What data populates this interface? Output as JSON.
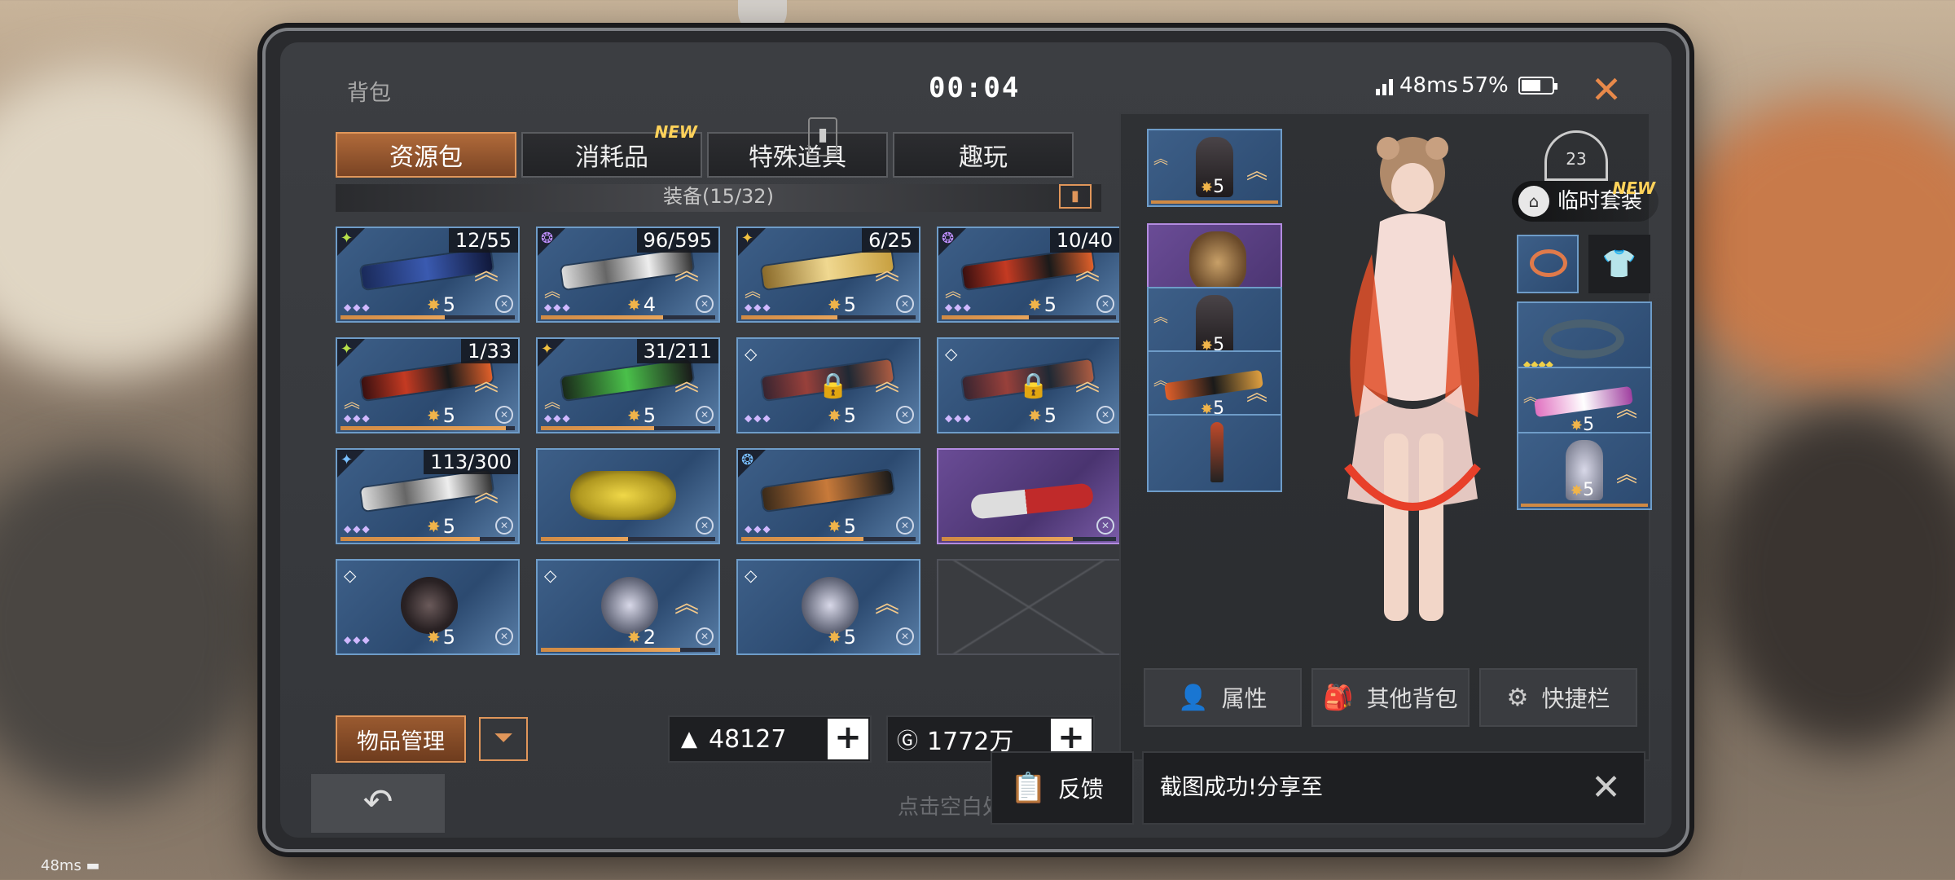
{
  "header": {
    "title": "背包",
    "timer": "00:04",
    "latency": "48ms",
    "battery": "57%",
    "close_icon": "close-icon"
  },
  "tabs": [
    {
      "label": "资源包",
      "active": true
    },
    {
      "label": "消耗品",
      "badge": "NEW"
    },
    {
      "label": "特殊道具"
    },
    {
      "label": "趣玩"
    }
  ],
  "section": {
    "label": "装备(15/32)"
  },
  "items": [
    {
      "count": "12/55",
      "stars": "5",
      "type": "weapon"
    },
    {
      "count": "96/595",
      "stars": "4",
      "type": "weapon"
    },
    {
      "count": "6/25",
      "stars": "5",
      "type": "weapon"
    },
    {
      "count": "10/40",
      "stars": "5",
      "type": "weapon"
    },
    {
      "count": "1/33",
      "stars": "5",
      "type": "weapon"
    },
    {
      "count": "31/211",
      "stars": "5",
      "type": "weapon"
    },
    {
      "count": "",
      "stars": "5",
      "type": "locked"
    },
    {
      "count": "",
      "stars": "5",
      "type": "locked"
    },
    {
      "count": "113/300",
      "stars": "5",
      "type": "weapon"
    },
    {
      "count": "",
      "stars": "",
      "type": "vehicle"
    },
    {
      "count": "",
      "stars": "5",
      "type": "weapon"
    },
    {
      "count": "",
      "stars": "",
      "type": "chainsaw"
    },
    {
      "count": "",
      "stars": "5",
      "type": "armor"
    },
    {
      "count": "",
      "stars": "2",
      "type": "vest"
    },
    {
      "count": "",
      "stars": "5",
      "type": "vest"
    },
    {
      "count": "",
      "stars": "",
      "type": "empty"
    }
  ],
  "footer": {
    "manage_label": "物品管理",
    "gold_value": "48127",
    "coin_value": "1772万",
    "close_hint": "点击空白处关闭"
  },
  "right": {
    "temp_outfit_label": "临时套装",
    "temp_outfit_badge": "NEW",
    "locker_number": "23",
    "equip_stars": [
      "5",
      "5",
      "5",
      "5",
      "5"
    ],
    "buttons": [
      "属性",
      "其他背包",
      "快捷栏"
    ]
  },
  "toast": {
    "feedback_label": "反馈",
    "message": "截图成功!分享至"
  },
  "overlay_latency": "48ms"
}
